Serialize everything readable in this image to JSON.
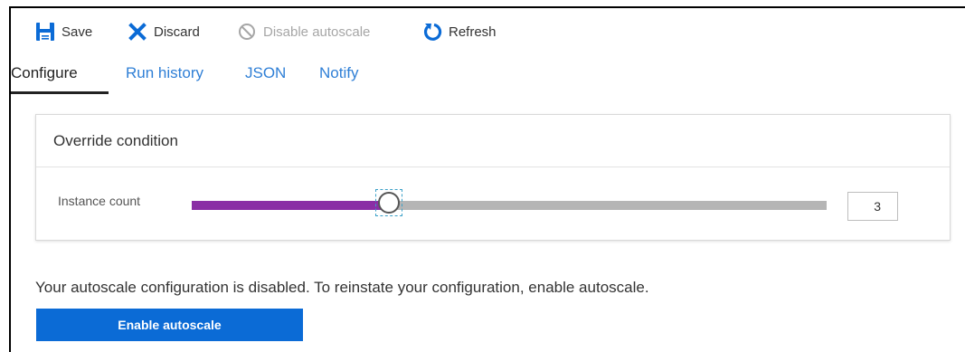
{
  "toolbar": {
    "save_label": "Save",
    "discard_label": "Discard",
    "disable_label": "Disable autoscale",
    "refresh_label": "Refresh",
    "icons": {
      "save": "save-icon",
      "discard": "discard-x-icon",
      "disable": "prohibited-icon",
      "refresh": "refresh-icon"
    },
    "colors": {
      "icon_blue": "#0b6bd6",
      "disabled": "#a6a6a6"
    }
  },
  "tabs": [
    {
      "label": "Configure",
      "active": true
    },
    {
      "label": "Run history",
      "active": false
    },
    {
      "label": "JSON",
      "active": false
    },
    {
      "label": "Notify",
      "active": false
    }
  ],
  "override": {
    "title": "Override condition",
    "instance_label": "Instance count",
    "instance_value": "3",
    "slider_fraction": 0.31,
    "colors": {
      "fill": "#8a2ea5",
      "track": "#b5b5b5"
    }
  },
  "message": "Your autoscale configuration is disabled. To reinstate your configuration, enable autoscale.",
  "enable_button_label": "Enable autoscale",
  "colors": {
    "accent": "#0b6bd6",
    "link": "#2f7fd6"
  }
}
